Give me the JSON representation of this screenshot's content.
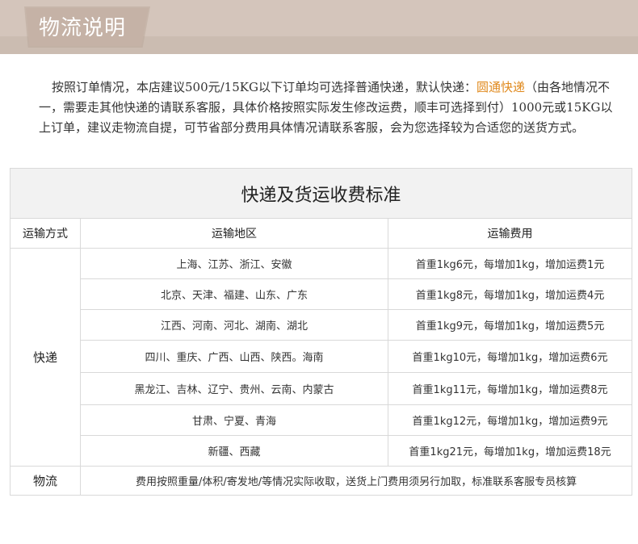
{
  "header": {
    "title": "物流说明"
  },
  "intro": {
    "part1": "按照订单情况，本店建议500元/15KG以下订单均可选择普通快递，默认快递：",
    "default_courier": "圆通快递",
    "part2": "（由各地情况不一，需要走其他快递的请联系客服，具体价格按照实际发生修改运费，顺丰可选择到付）1000元或15KG以上订单，建议走物流自提，可节省部分费用具体情况请联系客服，会为您选择较为合适您的送货方式。"
  },
  "table": {
    "caption": "快递及货运收费标准",
    "headers": {
      "mode": "运输方式",
      "region": "运输地区",
      "fee": "运输费用"
    },
    "express_label": "快递",
    "express_rows": [
      {
        "region": "上海、江苏、浙江、安徽",
        "fee": "首重1kg6元，每增加1kg，增加运费1元"
      },
      {
        "region": "北京、天津、福建、山东、广东",
        "fee": "首重1kg8元，每增加1kg，增加运费4元"
      },
      {
        "region": "江西、河南、河北、湖南、湖北",
        "fee": "首重1kg9元，每增加1kg，增加运费5元"
      },
      {
        "region": "四川、重庆、广西、山西、陕西。海南",
        "fee": "首重1kg10元，每增加1kg，增加运费6元"
      },
      {
        "region": "黑龙江、吉林、辽宁、贵州、云南、内蒙古",
        "fee": "首重1kg11元，每增加1kg，增加运费8元"
      },
      {
        "region": "甘肃、宁夏、青海",
        "fee": "首重1kg12元，每增加1kg，增加运费9元"
      },
      {
        "region": "新疆、西藏",
        "fee": "首重1kg21元，每增加1kg，增加运费18元"
      }
    ],
    "logistics_label": "物流",
    "logistics_note": "费用按照重量/体积/寄发地/等情况实际收取，送货上门费用须另行加取，标准联系客服专员核算"
  },
  "colors": {
    "banner": "#d4c5bb",
    "tab": "#c5b2a6",
    "highlight": "#e08a1e"
  }
}
